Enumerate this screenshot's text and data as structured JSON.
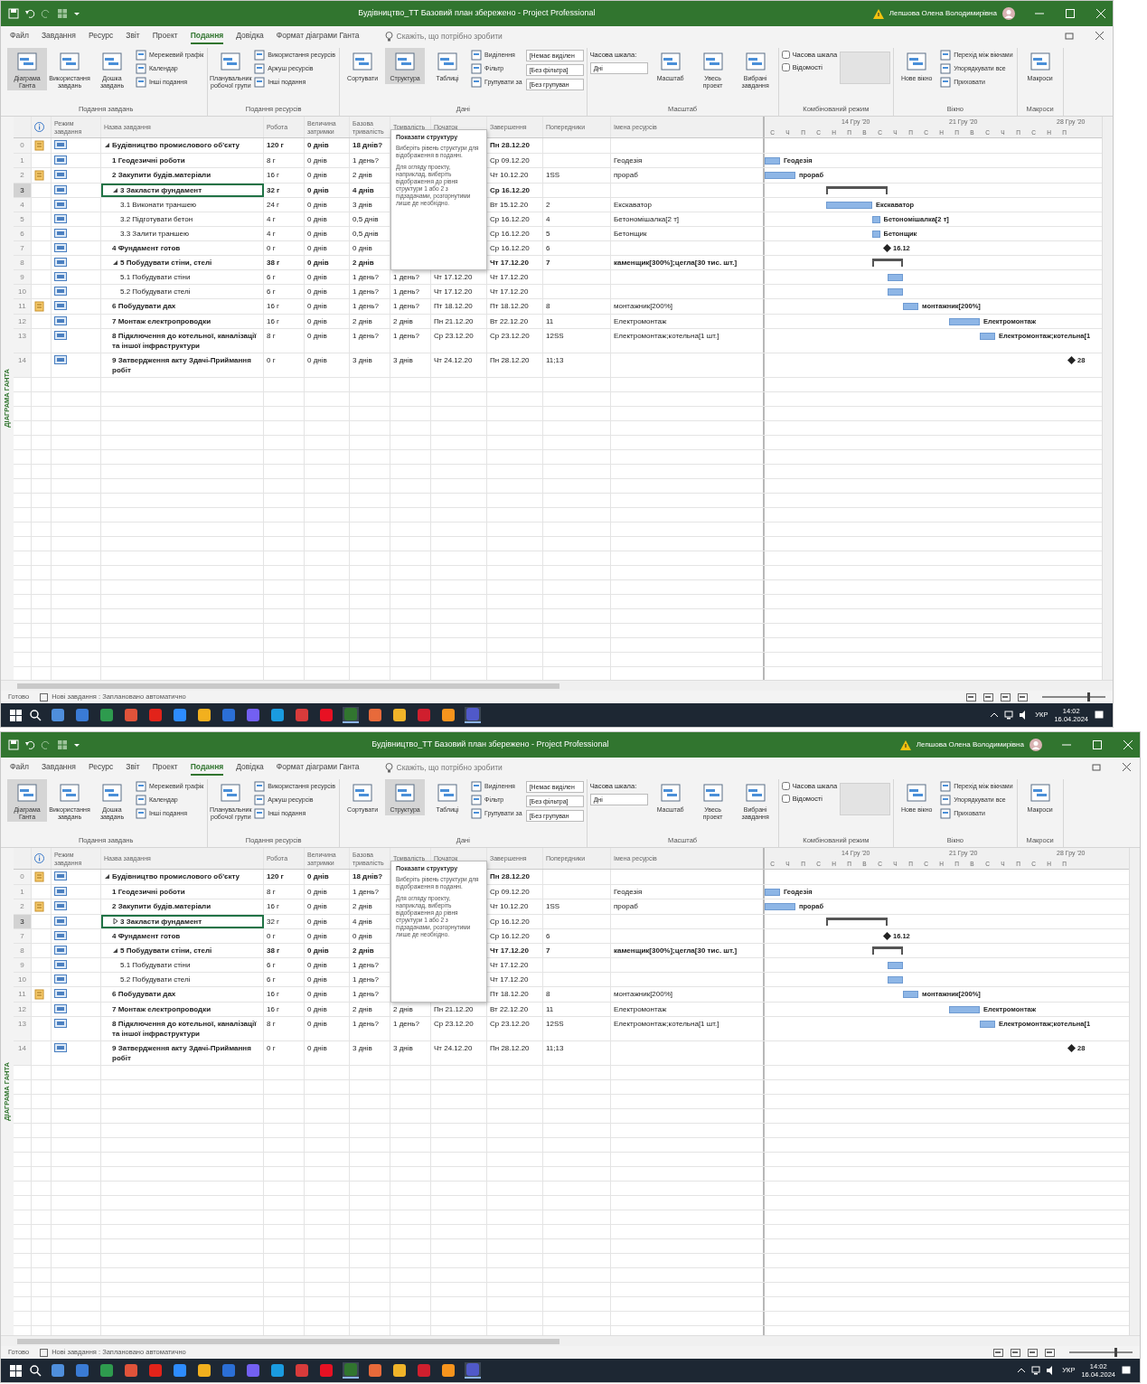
{
  "windows": [
    {
      "title_bar": {
        "title": "Будівництво_ТТ Базовий план збережено - Project Professional",
        "user": "Лепшова Олена Володимирівна"
      },
      "ribbon_tabs": [
        {
          "label": "Файл",
          "selected": false
        },
        {
          "label": "Завдання",
          "selected": false
        },
        {
          "label": "Ресурс",
          "selected": false
        },
        {
          "label": "Звіт",
          "selected": false
        },
        {
          "label": "Проект",
          "selected": false
        },
        {
          "label": "Подання",
          "selected": true
        },
        {
          "label": "Довідка",
          "selected": false
        },
        {
          "label": "Формат діаграми Ганта",
          "selected": false
        }
      ],
      "tell_me": {
        "placeholder": "Скажіть, що потрібно зробити"
      },
      "ribbon_groups": [
        {
          "label": "Подання завдань",
          "items": [
            {
              "kind": "large",
              "label": "Діаграма Ганта",
              "active": true
            },
            {
              "kind": "large",
              "label": "Використання завдань",
              "active": false
            },
            {
              "kind": "large",
              "label": "Дошка завдань",
              "active": false
            },
            {
              "kind": "stack",
              "labels": [
                "Мережевий графік",
                "Календар",
                "Інші подання"
              ]
            }
          ]
        },
        {
          "label": "Подання ресурсів",
          "items": [
            {
              "kind": "large",
              "label": "Планувальник робочої групи",
              "active": false
            },
            {
              "kind": "stack",
              "labels": [
                "Використання ресурсів",
                "Аркуш ресурсів",
                "Інші подання"
              ]
            }
          ]
        },
        {
          "label": "Дані",
          "items": [
            {
              "kind": "large",
              "label": "Сортувати",
              "active": false
            },
            {
              "kind": "large",
              "label": "Структура",
              "active": true
            },
            {
              "kind": "large",
              "label": "Таблиці",
              "active": false
            },
            {
              "kind": "stack",
              "labels": [
                "Виділення",
                "Фільтр",
                "Групувати за"
              ]
            },
            {
              "kind": "combos",
              "labels": [
                "[Немає виділен",
                "[Без фільтра]",
                "[Без групуван"
              ]
            }
          ]
        },
        {
          "label": "Масштаб",
          "items": [
            {
              "kind": "field",
              "label": "Часова шкала:",
              "value": "Дні"
            },
            {
              "kind": "large",
              "label": "Масштаб",
              "active": false
            },
            {
              "kind": "large",
              "label": "Увесь проект",
              "active": false
            },
            {
              "kind": "large",
              "label": "Вибрані завдання",
              "active": false
            }
          ]
        },
        {
          "label": "Комбінований режим",
          "items": [
            {
              "kind": "checks",
              "boxes": [
                {
                  "label": "Часова шкала",
                  "checked": false
                },
                {
                  "label": "Відомості",
                  "checked": false
                }
              ]
            },
            {
              "kind": "blank"
            }
          ]
        },
        {
          "label": "Вікно",
          "items": [
            {
              "kind": "large",
              "label": "Нове вікно",
              "active": false
            },
            {
              "kind": "stack",
              "labels": [
                "Перехід між вікнами",
                "Упорядкувати все",
                "Приховати"
              ]
            }
          ]
        },
        {
          "label": "Макроси",
          "items": [
            {
              "kind": "large",
              "label": "Макроси",
              "active": false
            }
          ]
        }
      ],
      "side_label": "ДІАГРАМА ГАНТА",
      "columns": [
        "Режим завдання",
        "Назва завдання",
        "Робота",
        "Величина затримки",
        "Базова тривалість",
        "Тривалість",
        "Початок",
        "Завершення",
        "Попередники",
        "Імена ресурсів"
      ],
      "tooltip": {
        "title": "Показати структуру",
        "paragraphs": [
          "Виберіть рівень структури для відображення в поданні.",
          "Для огляду проекту, наприклад, виберіть відображення до рівня структури 1 або 2 з підзадачами, розгорнутими лише де необхідно."
        ]
      },
      "timescale": {
        "weeks": [
          "14 Гру '20",
          "21 Гру '20",
          "28 Гру '20"
        ],
        "days": [
          "С",
          "Ч",
          "П",
          "С",
          "Н",
          "П",
          "В",
          "С",
          "Ч",
          "П",
          "С",
          "Н",
          "П",
          "В",
          "С",
          "Ч",
          "П",
          "С",
          "Н",
          "П"
        ]
      },
      "rows": [
        {
          "id": "0",
          "note": true,
          "name": "Будівництво промислового об'єкту",
          "work": "120 г",
          "delay": "0 днів",
          "baseline": "18 днів?",
          "finish": "Пн 28.12.20",
          "selected": false,
          "expanded": true,
          "children": [
            {
              "id": "1",
              "name": "1 Геодезичні роботи",
              "work": "8 г",
              "delay": "0 днів",
              "baseline": "1 день?",
              "finish": "Ср 09.12.20",
              "resources": "Геодезія",
              "selected": false,
              "bar": {
                "kind": "task",
                "label": "Геодезія"
              }
            },
            {
              "id": "2",
              "note": true,
              "name": "2 Закупити будів.матеріали",
              "work": "16 г",
              "delay": "0 днів",
              "baseline": "2 днів",
              "finish": "Чт 10.12.20",
              "predecessors": "1SS",
              "resources": "прораб",
              "selected": false,
              "bar": {
                "kind": "task",
                "label": "прораб"
              }
            },
            {
              "id": "3",
              "name": "3 Закласти фундамент",
              "work": "32 г",
              "delay": "0 днів",
              "baseline": "4 днів",
              "finish": "Ср 16.12.20",
              "selected": true,
              "expanded": true,
              "bar": {
                "kind": "summary"
              },
              "children": [
                {
                  "id": "4",
                  "name": "3.1 Виконати траншею",
                  "work": "24 г",
                  "delay": "0 днів",
                  "baseline": "3 днів",
                  "finish": "Вт 15.12.20",
                  "predecessors": "2",
                  "resources": "Екскаватор",
                  "selected": false,
                  "bar": {
                    "kind": "task",
                    "label": "Екскаватор"
                  }
                },
                {
                  "id": "5",
                  "name": "3.2 Підготувати бетон",
                  "work": "4 г",
                  "delay": "0 днів",
                  "baseline": "0,5 днів",
                  "finish": "Ср 16.12.20",
                  "predecessors": "4",
                  "resources": "Бетономішалка[2 т]",
                  "selected": false,
                  "bar": {
                    "kind": "task",
                    "label": "Бетономішалка[2 т]"
                  }
                },
                {
                  "id": "6",
                  "name": "3.3 Залити траншею",
                  "work": "4 г",
                  "delay": "0 днів",
                  "baseline": "0,5 днів",
                  "finish": "Ср 16.12.20",
                  "predecessors": "5",
                  "resources": "Бетонщик",
                  "selected": false,
                  "bar": {
                    "kind": "task",
                    "label": "Бетонщик"
                  }
                }
              ]
            },
            {
              "id": "7",
              "name": "4 Фундамент готов",
              "work": "0 г",
              "delay": "0 днів",
              "baseline": "0 днів",
              "finish": "Ср 16.12.20",
              "predecessors": "6",
              "selected": false,
              "bar": {
                "kind": "milestone",
                "label": "16.12"
              }
            },
            {
              "id": "8",
              "name": "5 Побудувати стіни, стелі",
              "work": "38 г",
              "delay": "0 днів",
              "baseline": "2 днів",
              "finish": "Чт 17.12.20",
              "predecessors": "7",
              "resources": "каменщик[300%];цегла[30 тис. шт.]",
              "selected": false,
              "expanded": true,
              "bar": {
                "kind": "summary"
              },
              "children": [
                {
                  "id": "9",
                  "name": "5.1 Побудувати стіни",
                  "work": "6 г",
                  "delay": "0 днів",
                  "baseline": "1 день?",
                  "duration": "1 день?",
                  "start": "Чт 17.12.20",
                  "finish": "Чт 17.12.20",
                  "selected": false,
                  "bar": {
                    "kind": "task"
                  }
                },
                {
                  "id": "10",
                  "name": "5.2 Побудувати стелі",
                  "work": "6 г",
                  "delay": "0 днів",
                  "baseline": "1 день?",
                  "duration": "1 день?",
                  "start": "Чт 17.12.20",
                  "finish": "Чт 17.12.20",
                  "selected": false,
                  "bar": {
                    "kind": "task"
                  }
                }
              ]
            },
            {
              "id": "11",
              "note": true,
              "name": "6 Побудувати дах",
              "work": "16 г",
              "delay": "0 днів",
              "baseline": "1 день?",
              "duration": "1 день?",
              "start": "Пт 18.12.20",
              "finish": "Пт 18.12.20",
              "predecessors": "8",
              "resources": "монтажник[200%]",
              "selected": false,
              "bar": {
                "kind": "task",
                "label": "монтажник[200%]"
              }
            },
            {
              "id": "12",
              "name": "7 Монтаж електропроводки",
              "work": "16 г",
              "delay": "0 днів",
              "baseline": "2 днів",
              "duration": "2 днів",
              "start": "Пн 21.12.20",
              "finish": "Вт 22.12.20",
              "predecessors": "11",
              "resources": "Електромонтаж",
              "selected": false,
              "bar": {
                "kind": "task",
                "label": "Електромонтаж"
              }
            },
            {
              "id": "13",
              "name": "8 Підключення до котельної, каналізації та іншої інфраструктури",
              "work": "8 г",
              "delay": "0 днів",
              "baseline": "1 день?",
              "duration": "1 день?",
              "start": "Ср 23.12.20",
              "finish": "Ср 23.12.20",
              "predecessors": "12SS",
              "resources": "Електромонтаж;котельна[1 шт.]",
              "selected": false,
              "bar": {
                "kind": "task",
                "label": "Електромонтаж;котельна[1"
              }
            },
            {
              "id": "14",
              "name": "9 Затвердження акту Здачі-Приймання робіт",
              "work": "0 г",
              "delay": "0 днів",
              "baseline": "3 днів",
              "duration": "3 днів",
              "start": "Чт 24.12.20",
              "finish": "Пн 28.12.20",
              "predecessors": "11;13",
              "selected": false,
              "bar": {
                "kind": "milestone",
                "label": "28"
              }
            }
          ]
        }
      ],
      "status_bar": {
        "mode": "Готово",
        "new_tasks": "Нові завдання : Заплановано автоматично",
        "zoom": {
          "level": 0.72
        }
      },
      "taskbar": {
        "apps": [
          {
            "color": "#4f8fdc",
            "active": false
          },
          {
            "color": "#3a7bd5",
            "active": false
          },
          {
            "color": "#2e9b4e",
            "active": false
          },
          {
            "color": "#e0533a",
            "active": false
          },
          {
            "color": "#e2231a",
            "active": false
          },
          {
            "color": "#2d8cff",
            "active": false
          },
          {
            "color": "#f2b01e",
            "active": false
          },
          {
            "color": "#2b6fd6",
            "active": false
          },
          {
            "color": "#7360f2",
            "active": false
          },
          {
            "color": "#1a9be0",
            "active": false
          },
          {
            "color": "#d83b3b",
            "active": false
          },
          {
            "color": "#e81123",
            "active": false
          },
          {
            "color": "#31752f",
            "active": true
          },
          {
            "color": "#e86a3a",
            "active": false
          },
          {
            "color": "#f0b429",
            "active": false
          },
          {
            "color": "#d01f2e",
            "active": false
          },
          {
            "color": "#f7941d",
            "active": false
          },
          {
            "color": "#5059c9",
            "active": true
          }
        ],
        "lang": "УКР",
        "time": "14:02",
        "date": "16.04.2024"
      }
    },
    {
      "title_bar": {
        "title": "Будівництво_ТТ Базовий план збережено - Project Professional",
        "user": "Лепшова Олена Володимирівна"
      },
      "ribbon_tabs": [
        {
          "label": "Файл",
          "selected": false
        },
        {
          "label": "Завдання",
          "selected": false
        },
        {
          "label": "Ресурс",
          "selected": false
        },
        {
          "label": "Звіт",
          "selected": false
        },
        {
          "label": "Проект",
          "selected": false
        },
        {
          "label": "Подання",
          "selected": true
        },
        {
          "label": "Довідка",
          "selected": false
        },
        {
          "label": "Формат діаграми Ганта",
          "selected": false
        }
      ],
      "tell_me": {
        "placeholder": "Скажіть, що потрібно зробити"
      },
      "ribbon_groups": [
        {
          "label": "Подання завдань",
          "items": [
            {
              "kind": "large",
              "label": "Діаграма Ганта",
              "active": true
            },
            {
              "kind": "large",
              "label": "Використання завдань",
              "active": false
            },
            {
              "kind": "large",
              "label": "Дошка завдань",
              "active": false
            },
            {
              "kind": "stack",
              "labels": [
                "Мережевий графік",
                "Календар",
                "Інші подання"
              ]
            }
          ]
        },
        {
          "label": "Подання ресурсів",
          "items": [
            {
              "kind": "large",
              "label": "Планувальник робочої групи",
              "active": false
            },
            {
              "kind": "stack",
              "labels": [
                "Використання ресурсів",
                "Аркуш ресурсів",
                "Інші подання"
              ]
            }
          ]
        },
        {
          "label": "Дані",
          "items": [
            {
              "kind": "large",
              "label": "Сортувати",
              "active": false
            },
            {
              "kind": "large",
              "label": "Структура",
              "active": true
            },
            {
              "kind": "large",
              "label": "Таблиці",
              "active": false
            },
            {
              "kind": "stack",
              "labels": [
                "Виділення",
                "Фільтр",
                "Групувати за"
              ]
            },
            {
              "kind": "combos",
              "labels": [
                "[Немає виділен",
                "[Без фільтра]",
                "[Без групуван"
              ]
            }
          ]
        },
        {
          "label": "Масштаб",
          "items": [
            {
              "kind": "field",
              "label": "Часова шкала:",
              "value": "Дні"
            },
            {
              "kind": "large",
              "label": "Масштаб",
              "active": false
            },
            {
              "kind": "large",
              "label": "Увесь проект",
              "active": false
            },
            {
              "kind": "large",
              "label": "Вибрані завдання",
              "active": false
            }
          ]
        },
        {
          "label": "Комбінований режим",
          "items": [
            {
              "kind": "checks",
              "boxes": [
                {
                  "label": "Часова шкала",
                  "checked": false
                },
                {
                  "label": "Відомості",
                  "checked": false
                }
              ]
            },
            {
              "kind": "blank"
            }
          ]
        },
        {
          "label": "Вікно",
          "items": [
            {
              "kind": "large",
              "label": "Нове вікно",
              "active": false
            },
            {
              "kind": "stack",
              "labels": [
                "Перехід між вікнами",
                "Упорядкувати все",
                "Приховати"
              ]
            }
          ]
        },
        {
          "label": "Макроси",
          "items": [
            {
              "kind": "large",
              "label": "Макроси",
              "active": false
            }
          ]
        }
      ],
      "side_label": "ДІАГРАМА ГАНТА",
      "columns": [
        "Режим завдання",
        "Назва завдання",
        "Робота",
        "Величина затримки",
        "Базова тривалість",
        "Тривалість",
        "Початок",
        "Завершення",
        "Попередники",
        "Імена ресурсів"
      ],
      "tooltip": {
        "title": "Показати структуру",
        "paragraphs": [
          "Виберіть рівень структури для відображення в поданні.",
          "Для огляду проекту, наприклад, виберіть відображення до рівня структури 1 або 2 з підзадачами, розгорнутими лише де необхідно."
        ]
      },
      "timescale": {
        "weeks": [
          "14 Гру '20",
          "21 Гру '20",
          "28 Гру '20"
        ],
        "days": [
          "С",
          "Ч",
          "П",
          "С",
          "Н",
          "П",
          "В",
          "С",
          "Ч",
          "П",
          "С",
          "Н",
          "П",
          "В",
          "С",
          "Ч",
          "П",
          "С",
          "Н",
          "П"
        ]
      },
      "rows": [
        {
          "id": "0",
          "note": true,
          "name": "Будівництво промислового об'єкту",
          "work": "120 г",
          "delay": "0 днів",
          "baseline": "18 днів?",
          "finish": "Пн 28.12.20",
          "selected": false,
          "expanded": true,
          "children": [
            {
              "id": "1",
              "name": "1 Геодезичні роботи",
              "work": "8 г",
              "delay": "0 днів",
              "baseline": "1 день?",
              "finish": "Ср 09.12.20",
              "resources": "Геодезія",
              "selected": false,
              "bar": {
                "kind": "task",
                "label": "Геодезія"
              }
            },
            {
              "id": "2",
              "note": true,
              "name": "2 Закупити будів.матеріали",
              "work": "16 г",
              "delay": "0 днів",
              "baseline": "2 днів",
              "finish": "Чт 10.12.20",
              "predecessors": "1SS",
              "resources": "прораб",
              "selected": false,
              "bar": {
                "kind": "task",
                "label": "прораб"
              }
            },
            {
              "id": "3",
              "name": "3 Закласти фундамент",
              "work": "32 г",
              "delay": "0 днів",
              "baseline": "4 днів",
              "finish": "Ср 16.12.20",
              "selected": true,
              "expanded": false,
              "bar": {
                "kind": "summary"
              }
            },
            {
              "id": "7",
              "name": "4 Фундамент готов",
              "work": "0 г",
              "delay": "0 днів",
              "baseline": "0 днів",
              "finish": "Ср 16.12.20",
              "predecessors": "6",
              "selected": false,
              "bar": {
                "kind": "milestone",
                "label": "16.12"
              }
            },
            {
              "id": "8",
              "name": "5 Побудувати стіни, стелі",
              "work": "38 г",
              "delay": "0 днів",
              "baseline": "2 днів",
              "finish": "Чт 17.12.20",
              "predecessors": "7",
              "resources": "каменщик[300%];цегла[30 тис. шт.]",
              "selected": false,
              "expanded": true,
              "bar": {
                "kind": "summary"
              },
              "children": [
                {
                  "id": "9",
                  "name": "5.1 Побудувати стіни",
                  "work": "6 г",
                  "delay": "0 днів",
                  "baseline": "1 день?",
                  "finish": "Чт 17.12.20",
                  "selected": false,
                  "bar": {
                    "kind": "task"
                  }
                },
                {
                  "id": "10",
                  "name": "5.2 Побудувати стелі",
                  "work": "6 г",
                  "delay": "0 днів",
                  "baseline": "1 день?",
                  "finish": "Чт 17.12.20",
                  "selected": false,
                  "bar": {
                    "kind": "task"
                  }
                }
              ]
            },
            {
              "id": "11",
              "note": true,
              "name": "6 Побудувати дах",
              "work": "16 г",
              "delay": "0 днів",
              "baseline": "1 день?",
              "finish": "Пт 18.12.20",
              "predecessors": "8",
              "resources": "монтажник[200%]",
              "selected": false,
              "bar": {
                "kind": "task",
                "label": "монтажник[200%]"
              }
            },
            {
              "id": "12",
              "name": "7 Монтаж електропроводки",
              "work": "16 г",
              "delay": "0 днів",
              "baseline": "2 днів",
              "duration": "2 днів",
              "start": "Пн 21.12.20",
              "finish": "Вт 22.12.20",
              "predecessors": "11",
              "resources": "Електромонтаж",
              "selected": false,
              "bar": {
                "kind": "task",
                "label": "Електромонтаж"
              }
            },
            {
              "id": "13",
              "name": "8 Підключення до котельної, каналізації та іншої інфраструктури",
              "work": "8 г",
              "delay": "0 днів",
              "baseline": "1 день?",
              "duration": "1 день?",
              "start": "Ср 23.12.20",
              "finish": "Ср 23.12.20",
              "predecessors": "12SS",
              "resources": "Електромонтаж;котельна[1 шт.]",
              "selected": false,
              "bar": {
                "kind": "task",
                "label": "Електромонтаж;котельна[1"
              }
            },
            {
              "id": "14",
              "name": "9 Затвердження акту Здачі-Приймання робіт",
              "work": "0 г",
              "delay": "0 днів",
              "baseline": "3 днів",
              "duration": "3 днів",
              "start": "Чт 24.12.20",
              "finish": "Пн 28.12.20",
              "predecessors": "11;13",
              "selected": false,
              "bar": {
                "kind": "milestone",
                "label": "28"
              }
            }
          ]
        }
      ],
      "status_bar": {
        "mode": "Готово",
        "new_tasks": "Нові завдання : Заплановано автоматично",
        "zoom": {
          "level": 0.72
        }
      },
      "taskbar": {
        "apps": [
          {
            "color": "#4f8fdc",
            "active": false
          },
          {
            "color": "#3a7bd5",
            "active": false
          },
          {
            "color": "#2e9b4e",
            "active": false
          },
          {
            "color": "#e0533a",
            "active": false
          },
          {
            "color": "#e2231a",
            "active": false
          },
          {
            "color": "#2d8cff",
            "active": false
          },
          {
            "color": "#f2b01e",
            "active": false
          },
          {
            "color": "#2b6fd6",
            "active": false
          },
          {
            "color": "#7360f2",
            "active": false
          },
          {
            "color": "#1a9be0",
            "active": false
          },
          {
            "color": "#d83b3b",
            "active": false
          },
          {
            "color": "#e81123",
            "active": false
          },
          {
            "color": "#31752f",
            "active": true
          },
          {
            "color": "#e86a3a",
            "active": false
          },
          {
            "color": "#f0b429",
            "active": false
          },
          {
            "color": "#d01f2e",
            "active": false
          },
          {
            "color": "#f7941d",
            "active": false
          },
          {
            "color": "#5059c9",
            "active": true
          }
        ],
        "lang": "УКР",
        "time": "14:02",
        "date": "16.04.2024"
      }
    }
  ]
}
